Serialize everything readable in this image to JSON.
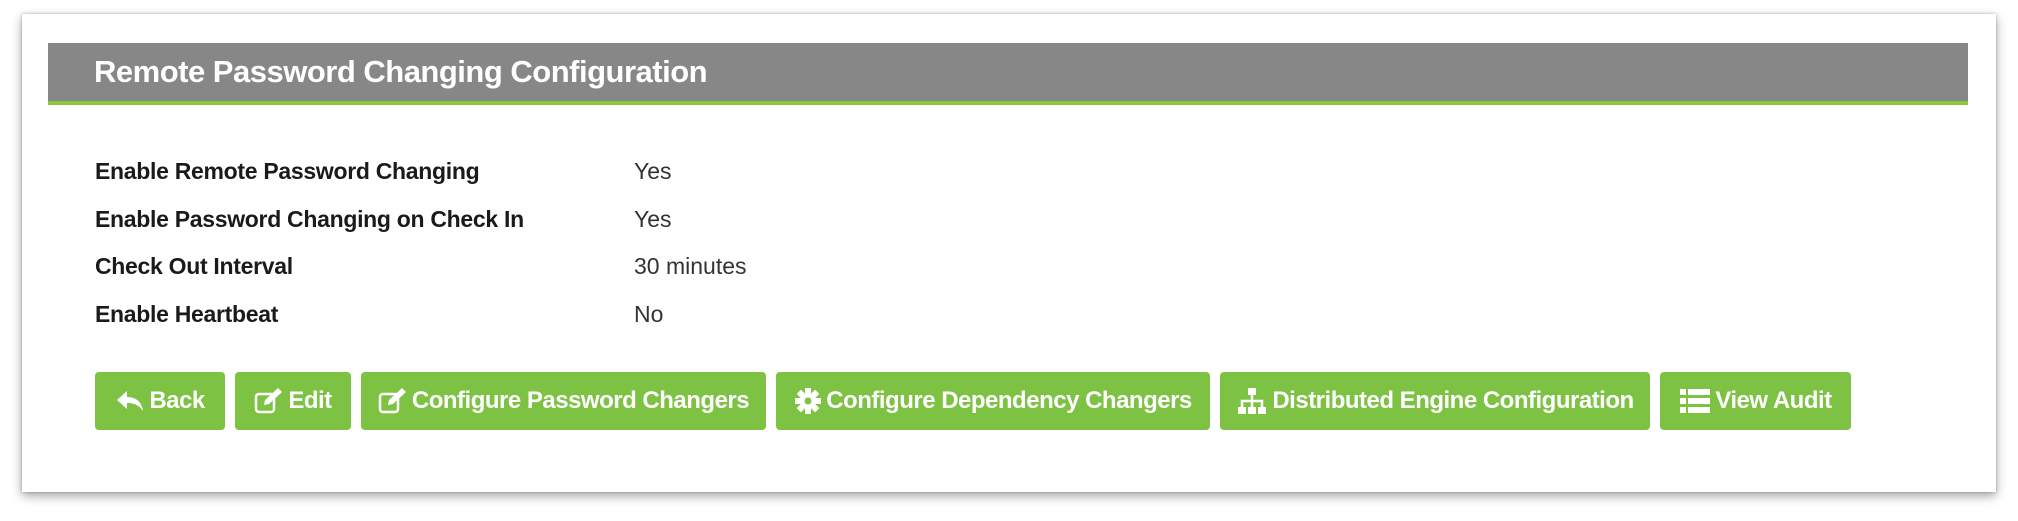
{
  "header": {
    "title": "Remote Password Changing Configuration"
  },
  "settings": [
    {
      "label": "Enable Remote Password Changing",
      "value": "Yes"
    },
    {
      "label": "Enable Password Changing on Check In",
      "value": "Yes"
    },
    {
      "label": "Check Out Interval",
      "value": "30 minutes"
    },
    {
      "label": "Enable Heartbeat",
      "value": "No"
    }
  ],
  "buttons": {
    "back": {
      "label": "Back",
      "icon": "reply-arrow-icon"
    },
    "edit": {
      "label": "Edit",
      "icon": "edit-icon"
    },
    "configure_password_changers": {
      "label": "Configure Password Changers",
      "icon": "edit-icon"
    },
    "configure_dependency_changers": {
      "label": "Configure Dependency Changers",
      "icon": "gear-icon"
    },
    "distributed_engine_configuration": {
      "label": "Distributed Engine Configuration",
      "icon": "sitemap-icon"
    },
    "view_audit": {
      "label": "View Audit",
      "icon": "list-icon"
    }
  },
  "colors": {
    "header_bg": "#878787",
    "accent": "#8cc63f",
    "button_bg": "#7dc242"
  }
}
